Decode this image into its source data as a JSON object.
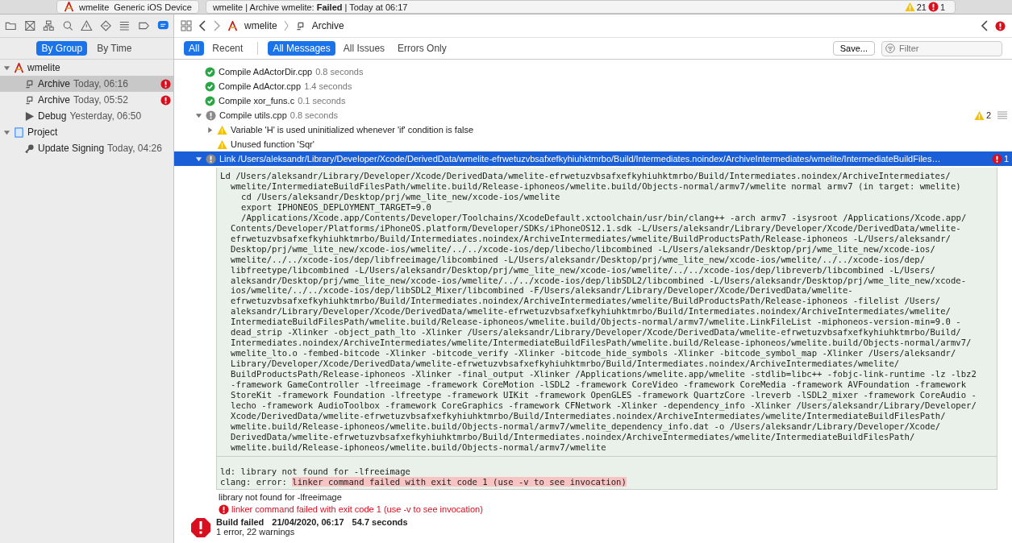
{
  "toolbar": {
    "scheme": "wmelite",
    "destination": "Generic iOS Device",
    "activity": "wmelite | Archive wmelite: **Failed** | Today at 06:17",
    "warnings": "21",
    "errors": "1"
  },
  "navigator": {
    "scopes": [
      {
        "label": "By Group",
        "selected": true
      },
      {
        "label": "By Time",
        "selected": false
      }
    ],
    "tree": [
      {
        "label": "wmelite",
        "kind": "project",
        "expanded": true,
        "children": [
          {
            "label": "Archive",
            "time": "Today, 06:16",
            "kind": "archive",
            "error": true,
            "selected": true
          },
          {
            "label": "Archive",
            "time": "Today, 05:52",
            "kind": "archive",
            "error": true,
            "selected": false
          },
          {
            "label": "Debug",
            "time": "Yesterday, 06:50",
            "kind": "debug",
            "error": false,
            "selected": false
          }
        ]
      },
      {
        "label": "Project",
        "kind": "document",
        "expanded": true,
        "children": [
          {
            "label": "Update Signing",
            "time": "Today, 04:26",
            "kind": "key",
            "error": false,
            "selected": false
          }
        ]
      }
    ]
  },
  "jump_bar": {
    "path": [
      "wmelite",
      "Archive"
    ]
  },
  "filter_bar": {
    "time_scopes": [
      {
        "label": "All",
        "selected": true
      },
      {
        "label": "Recent",
        "selected": false
      }
    ],
    "message_scopes": [
      {
        "label": "All Messages",
        "selected": true
      },
      {
        "label": "All Issues",
        "selected": false
      },
      {
        "label": "Errors Only",
        "selected": false
      }
    ],
    "save": "Save...",
    "placeholder": "Filter"
  },
  "log": [
    {
      "kind": "success",
      "title": "Compile AdActorDir.cpp",
      "duration": "0.8 seconds"
    },
    {
      "kind": "success",
      "title": "Compile AdActor.cpp",
      "duration": "1.4 seconds"
    },
    {
      "kind": "success",
      "title": "Compile xor_funs.c",
      "duration": "0.1 seconds"
    },
    {
      "kind": "group",
      "title": "Compile utils.cpp",
      "duration": "0.8 seconds",
      "expanded": true,
      "badge": {
        "kind": "warning",
        "count": "2"
      },
      "selected": false,
      "children": [
        {
          "kind": "warning",
          "title": "Variable 'H' is used uninitialized whenever 'if' condition is false",
          "expanded": false
        },
        {
          "kind": "warning",
          "title": "Unused function 'Sqr'"
        }
      ]
    },
    {
      "kind": "group",
      "title": "Link /Users/aleksandr/Library/Developer/Xcode/DerivedData/wmelite-efrwetuzvbsafxefkyhiuhktmrbo/Build/Intermediates.noindex/ArchiveIntermediates/wmelite/IntermediateBuildFiles…",
      "expanded": true,
      "badge": {
        "kind": "error",
        "count": "1"
      },
      "selected": true
    }
  ],
  "transcript": [
    {
      "kind": "head",
      "text": "Ld /Users/aleksandr/Library/Developer/Xcode/DerivedData/wmelite-efrwetuzvbsafxefkyhiuhktmrbo/Build/Intermediates.noindex/ArchiveIntermediates/"
    },
    {
      "kind": "wrap",
      "text": "wmelite/IntermediateBuildFilesPath/wmelite.build/Release-iphoneos/wmelite.build/Objects-normal/armv7/wmelite normal armv7 (in target: wmelite)"
    },
    {
      "kind": "sub",
      "text": "cd /Users/aleksandr/Desktop/prj/wme_lite_new/xcode-ios/wmelite"
    },
    {
      "kind": "sub",
      "text": "export IPHONEOS_DEPLOYMENT_TARGET=9.0"
    },
    {
      "kind": "sub",
      "text": "/Applications/Xcode.app/Contents/Developer/Toolchains/XcodeDefault.xctoolchain/usr/bin/clang++ -arch armv7 -isysroot /Applications/Xcode.app/"
    },
    {
      "kind": "wrap",
      "text": "Contents/Developer/Platforms/iPhoneOS.platform/Developer/SDKs/iPhoneOS12.1.sdk -L/Users/aleksandr/Library/Developer/Xcode/DerivedData/wmelite-"
    },
    {
      "kind": "wrap",
      "text": "efrwetuzvbsafxefkyhiuhktmrbo/Build/Intermediates.noindex/ArchiveIntermediates/wmelite/BuildProductsPath/Release-iphoneos -L/Users/aleksandr/"
    },
    {
      "kind": "wrap",
      "text": "Desktop/prj/wme_lite_new/xcode-ios/wmelite/../../xcode-ios/dep/libecho/libcombined -L/Users/aleksandr/Desktop/prj/wme_lite_new/xcode-ios/"
    },
    {
      "kind": "wrap",
      "text": "wmelite/../../xcode-ios/dep/libfreeimage/libcombined -L/Users/aleksandr/Desktop/prj/wme_lite_new/xcode-ios/wmelite/../../xcode-ios/dep/"
    },
    {
      "kind": "wrap",
      "text": "libfreetype/libcombined -L/Users/aleksandr/Desktop/prj/wme_lite_new/xcode-ios/wmelite/../../xcode-ios/dep/libreverb/libcombined -L/Users/"
    },
    {
      "kind": "wrap",
      "text": "aleksandr/Desktop/prj/wme_lite_new/xcode-ios/wmelite/../../xcode-ios/dep/libSDL2/libcombined -L/Users/aleksandr/Desktop/prj/wme_lite_new/xcode-"
    },
    {
      "kind": "wrap",
      "text": "ios/wmelite/../../xcode-ios/dep/libSDL2_Mixer/libcombined -F/Users/aleksandr/Library/Developer/Xcode/DerivedData/wmelite-"
    },
    {
      "kind": "wrap",
      "text": "efrwetuzvbsafxefkyhiuhktmrbo/Build/Intermediates.noindex/ArchiveIntermediates/wmelite/BuildProductsPath/Release-iphoneos -filelist /Users/"
    },
    {
      "kind": "wrap",
      "text": "aleksandr/Library/Developer/Xcode/DerivedData/wmelite-efrwetuzvbsafxefkyhiuhktmrbo/Build/Intermediates.noindex/ArchiveIntermediates/wmelite/"
    },
    {
      "kind": "wrap",
      "text": "IntermediateBuildFilesPath/wmelite.build/Release-iphoneos/wmelite.build/Objects-normal/armv7/wmelite.LinkFileList -miphoneos-version-min=9.0 -"
    },
    {
      "kind": "wrap",
      "text": "dead_strip -Xlinker -object_path_lto -Xlinker /Users/aleksandr/Library/Developer/Xcode/DerivedData/wmelite-efrwetuzvbsafxefkyhiuhktmrbo/Build/"
    },
    {
      "kind": "wrap",
      "text": "Intermediates.noindex/ArchiveIntermediates/wmelite/IntermediateBuildFilesPath/wmelite.build/Release-iphoneos/wmelite.build/Objects-normal/armv7/"
    },
    {
      "kind": "wrap",
      "text": "wmelite_lto.o -fembed-bitcode -Xlinker -bitcode_verify -Xlinker -bitcode_hide_symbols -Xlinker -bitcode_symbol_map -Xlinker /Users/aleksandr/"
    },
    {
      "kind": "wrap",
      "text": "Library/Developer/Xcode/DerivedData/wmelite-efrwetuzvbsafxefkyhiuhktmrbo/Build/Intermediates.noindex/ArchiveIntermediates/wmelite/"
    },
    {
      "kind": "wrap",
      "text": "BuildProductsPath/Release-iphoneos -Xlinker -final_output -Xlinker /Applications/wmelite.app/wmelite -stdlib=libc++ -fobjc-link-runtime -lz -lbz2"
    },
    {
      "kind": "wrap",
      "text": "-framework GameController -lfreeimage -framework CoreMotion -lSDL2 -framework CoreVideo -framework CoreMedia -framework AVFoundation -framework"
    },
    {
      "kind": "wrap",
      "text": "StoreKit -framework Foundation -lfreetype -framework UIKit -framework OpenGLES -framework QuartzCore -lreverb -lSDL2_mixer -framework CoreAudio -"
    },
    {
      "kind": "wrap",
      "text": "lecho -framework AudioToolbox -framework CoreGraphics -framework CFNetwork -Xlinker -dependency_info -Xlinker /Users/aleksandr/Library/Developer/"
    },
    {
      "kind": "wrap",
      "text": "Xcode/DerivedData/wmelite-efrwetuzvbsafxefkyhiuhktmrbo/Build/Intermediates.noindex/ArchiveIntermediates/wmelite/IntermediateBuildFilesPath/"
    },
    {
      "kind": "wrap",
      "text": "wmelite.build/Release-iphoneos/wmelite.build/Objects-normal/armv7/wmelite_dependency_info.dat -o /Users/aleksandr/Library/Developer/Xcode/"
    },
    {
      "kind": "wrap",
      "text": "DerivedData/wmelite-efrwetuzvbsafxefkyhiuhktmrbo/Build/Intermediates.noindex/ArchiveIntermediates/wmelite/IntermediateBuildFilesPath/"
    },
    {
      "kind": "wrap",
      "text": "wmelite.build/Release-iphoneos/wmelite.build/Objects-normal/armv7/wmelite"
    }
  ],
  "output": [
    {
      "kind": "plain",
      "text": "ld: library not found for -lfreeimage"
    },
    {
      "kind": "error",
      "prefix": "clang: error: ",
      "text": "linker command failed with exit code 1 (use -v to see invocation)"
    }
  ],
  "messages": [
    {
      "kind": "plain",
      "text": "library not found for -lfreeimage"
    },
    {
      "kind": "error",
      "text": "linker command failed with exit code 1 (use -v to see invocation)"
    }
  ],
  "summary": {
    "status": "Build failed",
    "date": "21/04/2020, 06:17",
    "duration": "54.7 seconds",
    "counts": "1 error, 22 warnings"
  }
}
